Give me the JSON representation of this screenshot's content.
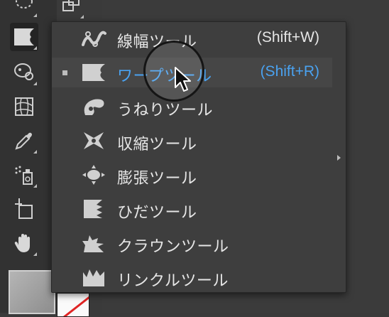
{
  "toolbar": {
    "tools": [
      {
        "name": "lasso-tool",
        "icon": "lasso-icon"
      },
      {
        "name": "shape-builder-tool",
        "icon": "shape-builder-icon"
      },
      {
        "name": "warp-tool",
        "icon": "warp-icon",
        "active": true
      },
      {
        "name": "puppet-warp-tool",
        "icon": "puppet-warp-icon"
      },
      {
        "name": "mesh-tool",
        "icon": "mesh-icon"
      },
      {
        "name": "eyedropper-tool",
        "icon": "eyedropper-icon"
      },
      {
        "name": "symbol-sprayer-tool",
        "icon": "symbol-sprayer-icon"
      },
      {
        "name": "artboard-tool",
        "icon": "artboard-icon"
      },
      {
        "name": "hand-tool",
        "icon": "hand-icon"
      }
    ],
    "fill_color": "#a6a6a6",
    "stroke_color": "none"
  },
  "menu": {
    "items": [
      {
        "label": "線幅ツール",
        "shortcut": "(Shift+W)",
        "icon": "width-tool-icon",
        "selected": false,
        "highlighted": false
      },
      {
        "label": "ワープツール",
        "shortcut": "(Shift+R)",
        "icon": "warp-tool-icon",
        "selected": true,
        "highlighted": true
      },
      {
        "label": "うねりツール",
        "shortcut": "",
        "icon": "twirl-tool-icon",
        "selected": false,
        "highlighted": false
      },
      {
        "label": "収縮ツール",
        "shortcut": "",
        "icon": "pucker-tool-icon",
        "selected": false,
        "highlighted": false
      },
      {
        "label": "膨張ツール",
        "shortcut": "",
        "icon": "bloat-tool-icon",
        "selected": false,
        "highlighted": false
      },
      {
        "label": "ひだツール",
        "shortcut": "",
        "icon": "scallop-tool-icon",
        "selected": false,
        "highlighted": false
      },
      {
        "label": "クラウンツール",
        "shortcut": "",
        "icon": "crystallize-tool-icon",
        "selected": false,
        "highlighted": false
      },
      {
        "label": "リンクルツール",
        "shortcut": "",
        "icon": "wrinkle-tool-icon",
        "selected": false,
        "highlighted": false
      }
    ],
    "highlight_color": "#4aa2f0"
  }
}
